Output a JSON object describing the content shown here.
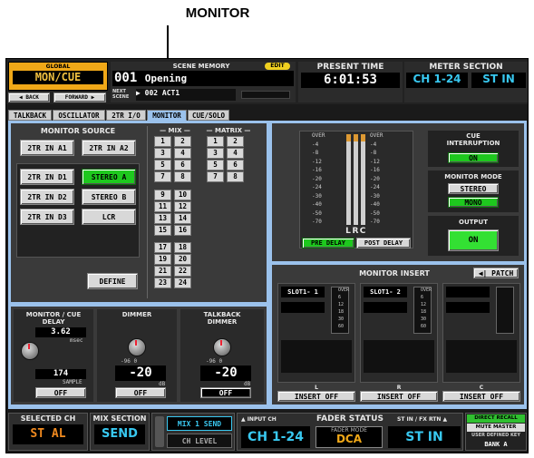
{
  "title": "MONITOR",
  "header": {
    "global_label": "GLOBAL",
    "mode": "MON/CUE",
    "back": "◀ BACK",
    "forward": "FORWARD ▶",
    "scene_memory_label": "SCENE MEMORY",
    "edit_badge": "EDIT",
    "scene_number": "001",
    "scene_name": "Opening",
    "next_scene_label": "NEXT\nSCENE",
    "next_scene": "▶ 002 ACT1",
    "present_time_label": "PRESENT TIME",
    "present_time": "6:01:53",
    "meter_section_label": "METER SECTION",
    "meter_ch": "CH 1-24",
    "meter_st": "ST IN"
  },
  "tabs": [
    "TALKBACK",
    "OSCILLATOR",
    "2TR I/O",
    "MONITOR",
    "CUE/SOLO"
  ],
  "monitor_source": {
    "title": "MONITOR SOURCE",
    "buttons": [
      "2TR IN A1",
      "2TR IN A2",
      "2TR IN D1",
      "STEREO A",
      "2TR IN D2",
      "STEREO B",
      "2TR IN D3",
      "LCR"
    ],
    "define": "DEFINE"
  },
  "mix": {
    "title": "— MIX —",
    "numbers": [
      "1",
      "2",
      "3",
      "4",
      "5",
      "6",
      "7",
      "8",
      "9",
      "10",
      "11",
      "12",
      "13",
      "14",
      "15",
      "16",
      "17",
      "18",
      "19",
      "20",
      "21",
      "22",
      "23",
      "24"
    ]
  },
  "matrix": {
    "title": "— MATRIX —",
    "numbers": [
      "1",
      "2",
      "3",
      "4",
      "5",
      "6",
      "7",
      "8"
    ]
  },
  "meters": {
    "scale": [
      "OVER",
      "-4",
      "-8",
      "-12",
      "-16",
      "-20",
      "-24",
      "-30",
      "-40",
      "-50",
      "-70"
    ],
    "channels": [
      "L",
      "R",
      "C"
    ],
    "pre_delay": "PRE DELAY",
    "post_delay": "POST DELAY"
  },
  "cue_interruption": {
    "label": "CUE\nINTERRUPTION",
    "state": "ON"
  },
  "monitor_mode": {
    "label": "MONITOR MODE",
    "options": [
      "STEREO",
      "MONO"
    ]
  },
  "output": {
    "label": "OUTPUT",
    "state": "ON"
  },
  "monitor_delay": {
    "label": "MONITOR / CUE\nDELAY",
    "ms": "3.62",
    "ms_unit": "msec",
    "samples": "174",
    "samples_unit": "SAMPLE",
    "state": "OFF"
  },
  "dimmer": {
    "label": "DIMMER",
    "range": "-96   0",
    "value": "-20",
    "unit": "dB",
    "state": "OFF"
  },
  "talkback_dimmer": {
    "label": "TALKBACK\nDIMMER",
    "range": "-96   0",
    "value": "-20",
    "unit": "dB",
    "state": "OFF"
  },
  "monitor_insert": {
    "title": "MONITOR INSERT",
    "patch": "◀| PATCH",
    "slots": [
      {
        "name": "SLOT1- 1",
        "channel": "L",
        "state": "INSERT OFF"
      },
      {
        "name": "SLOT1- 2",
        "channel": "R",
        "state": "INSERT OFF"
      },
      {
        "name": "",
        "channel": "C",
        "state": "INSERT OFF"
      }
    ],
    "scale": [
      "OVER",
      "6",
      "12",
      "18",
      "30",
      "60"
    ]
  },
  "footer": {
    "selected_ch_label": "SELECTED CH",
    "selected_ch": "ST AL",
    "mix_section_label": "MIX SECTION",
    "mix_section": "SEND",
    "mix1_send": "MIX 1 SEND",
    "ch_level": "CH LEVEL",
    "fader_status_label": "FADER STATUS",
    "input_ch_label": "▲ INPUT CH",
    "input_ch": "CH 1-24",
    "fader_mode_label": "FADER MODE",
    "fader_mode": "DCA",
    "st_in_label": "ST IN / FX RTN ▲",
    "st_in": "ST IN",
    "direct_recall": "DIRECT RECALL",
    "mute_master": "MUTE MASTER",
    "user_defined_key": "USER DEFINED KEY",
    "bank": "BANK A"
  },
  "colors": {
    "accent_green": "#1ec81e",
    "accent_cyan": "#30b8e8",
    "accent_orange": "#e08a10",
    "selected_tab": "#9bc2ec"
  }
}
